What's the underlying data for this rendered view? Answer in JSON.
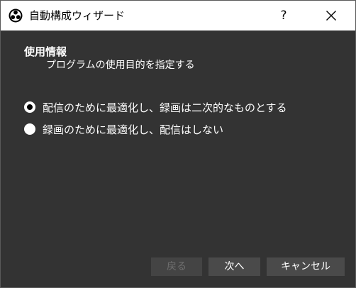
{
  "window": {
    "title": "自動構成ウィザード",
    "help_label": "?"
  },
  "section": {
    "title": "使用情報",
    "subtitle": "プログラムの使用目的を指定する"
  },
  "options": [
    {
      "label": "配信のために最適化し、録画は二次的なものとする",
      "selected": true
    },
    {
      "label": "録画のために最適化し、配信はしない",
      "selected": false
    }
  ],
  "buttons": {
    "back": "戻る",
    "next": "次へ",
    "cancel": "キャンセル"
  },
  "colors": {
    "background": "#333333",
    "titlebar": "#ffffff",
    "button": "#4a4a4a",
    "text": "#ffffff"
  }
}
